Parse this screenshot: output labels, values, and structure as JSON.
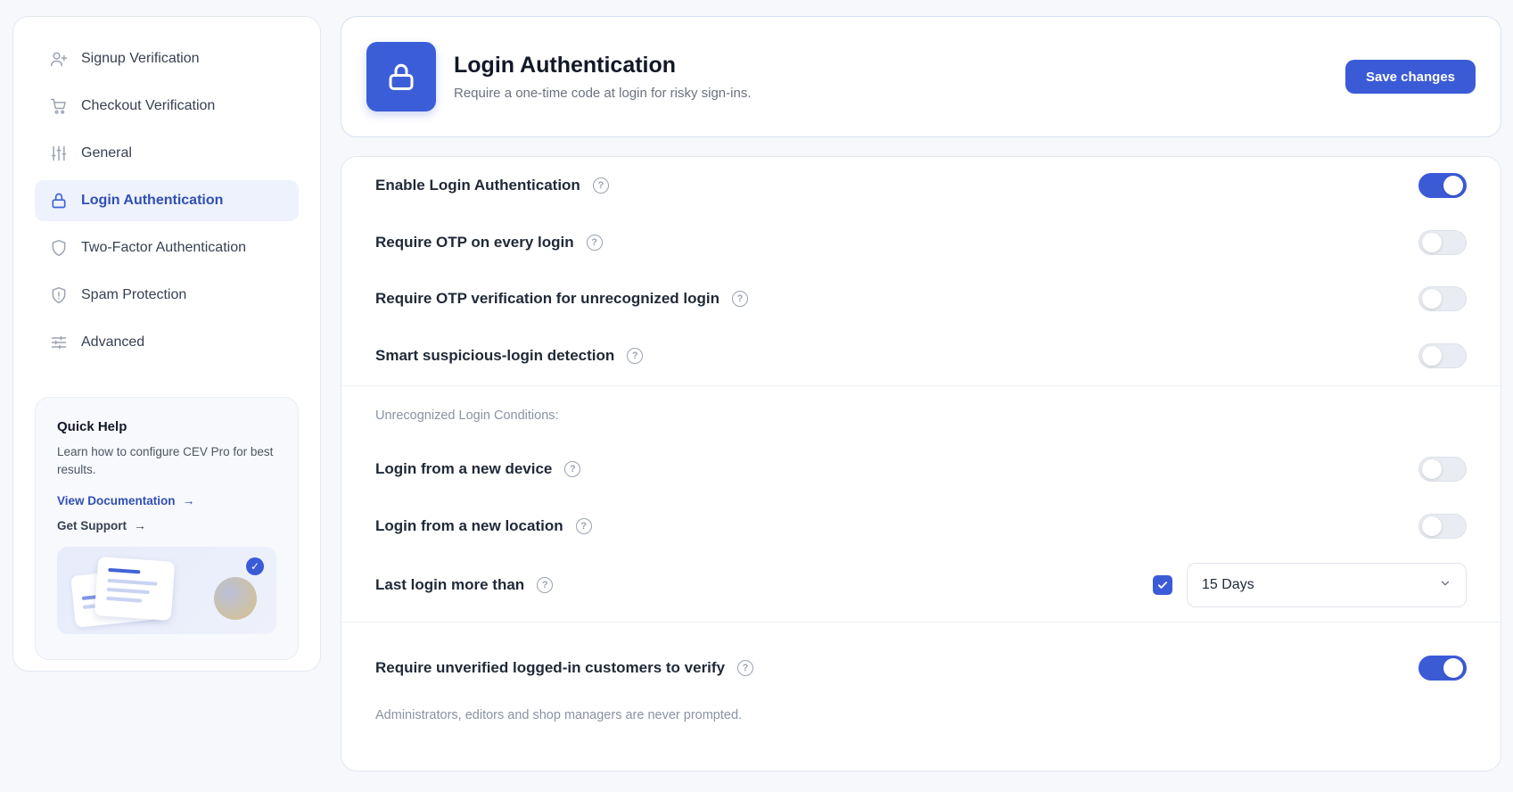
{
  "sidebar": {
    "items": [
      {
        "label": "Signup Verification",
        "icon": "user-plus-icon"
      },
      {
        "label": "Checkout Verification",
        "icon": "cart-icon"
      },
      {
        "label": "General",
        "icon": "sliders-icon"
      },
      {
        "label": "Login Authentication",
        "icon": "lock-icon",
        "active": true
      },
      {
        "label": "Two-Factor Authentication",
        "icon": "shield-icon"
      },
      {
        "label": "Spam Protection",
        "icon": "shield-alert-icon"
      },
      {
        "label": "Advanced",
        "icon": "settings-sliders-icon"
      }
    ],
    "quick_help": {
      "title": "Quick Help",
      "text": "Learn how to configure CEV Pro for best results.",
      "doc_link": "View Documentation",
      "support_link": "Get Support"
    }
  },
  "header": {
    "title": "Login Authentication",
    "subtitle": "Require a one-time code at login for risky sign-ins.",
    "save_label": "Save changes"
  },
  "settings": {
    "enable": {
      "label": "Enable Login Authentication",
      "on": true
    },
    "every_login": {
      "label": "Require OTP on every login",
      "on": false
    },
    "unrecognized": {
      "label": "Require OTP verification for unrecognized login",
      "on": false
    },
    "smart": {
      "label": "Smart suspicious-login detection",
      "on": false
    },
    "conditions_label": "Unrecognized Login Conditions:",
    "new_device": {
      "label": "Login from a new device",
      "on": false
    },
    "new_location": {
      "label": "Login from a new location",
      "on": false
    },
    "last_login": {
      "label": "Last login more than",
      "checked": true,
      "value": "15 Days"
    },
    "unverified": {
      "label": "Require unverified logged-in customers to verify",
      "on": true
    },
    "footnote": "Administrators, editors and shop managers are never prompted."
  },
  "colors": {
    "accent": "#3b5bd6",
    "background": "#f6f8fb"
  }
}
